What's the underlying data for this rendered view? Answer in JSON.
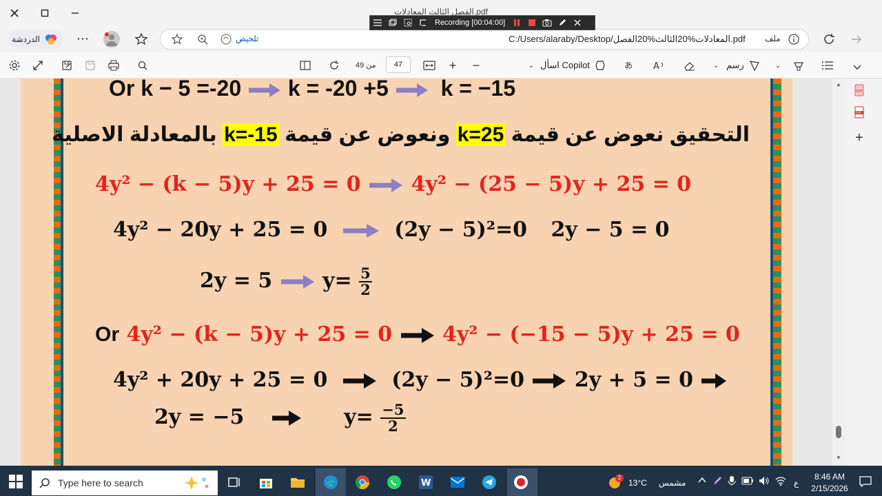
{
  "window": {
    "title": "الفصل الثالث المعادلات.pdf"
  },
  "recording": {
    "label": "Recording [00:04:00]"
  },
  "navbar": {
    "chat_label": "الدردشة",
    "summary_label": "تلخيص",
    "url": "C:/Users/alaraby/Desktop/المعادلات%20الثالث%20الفصل.pdf",
    "file_label": "ملف"
  },
  "pdf_toolbar": {
    "current_page": "47",
    "page_of": "من 49",
    "ask_copilot": "اسأل Copilot",
    "draw_label": "رسم"
  },
  "content": {
    "line1": "Or k − 5 =-20",
    "line1b": "k = -20 +5",
    "line1c": "k = −15",
    "verify_part1": "التحقيق نعوض عن  قيمة",
    "verify_hl1": "k=25",
    "verify_part2": "ونعوض عن قيمة",
    "verify_hl2": "k=-15",
    "verify_part3": "بالمعادلة الاصلية",
    "eq1_left": "4y² − (k − 5)y + 25 = 0",
    "eq1_right": "4y² − (25 − 5)y + 25 = 0",
    "eq2_left": "4y² − 20y + 25 = 0",
    "eq2_mid": "(2y − 5)²=0",
    "eq2_right": "2y − 5 = 0",
    "eq3_left": "2y = 5",
    "eq3_y": "y=",
    "eq3_num": "5",
    "eq3_den": "2",
    "or_label": "Or",
    "eq4_left": "4y² − (k − 5)y + 25 = 0",
    "eq4_right": "4y² − (−15 − 5)y + 25 = 0",
    "eq5_left": "4y² + 20y + 25 = 0",
    "eq5_mid": "(2y − 5)²=0",
    "eq5_right": "2y + 5 = 0",
    "eq6_left": "2y = −5",
    "eq6_y": "y=",
    "eq6_num": "−5",
    "eq6_den": "2"
  },
  "taskbar": {
    "search_placeholder": "Type here to search",
    "weather_temp": "13°C",
    "weather_desc": "مشمس",
    "weather_badge": "2",
    "lang": "ع",
    "time": "8:46 AM",
    "date": "2/15/2026"
  },
  "colors": {
    "page_bg": "#f8d3b1",
    "red_text": "#e4231d",
    "highlight": "#ffff00",
    "arrow_purple": "#8c7fc4",
    "taskbar": "#1f3246"
  }
}
